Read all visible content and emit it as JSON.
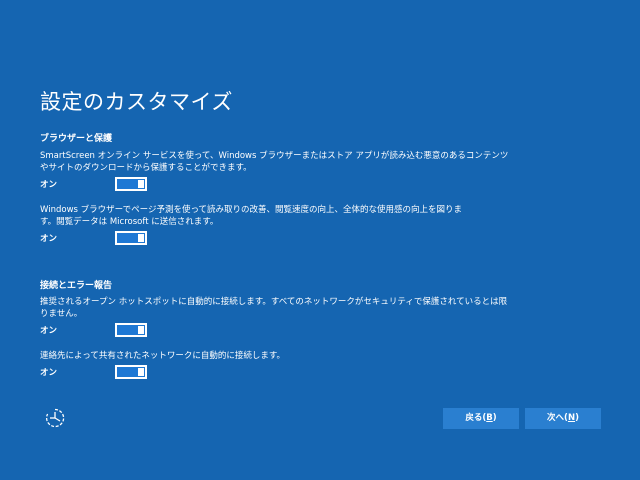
{
  "page": {
    "title": "設定のカスタマイズ"
  },
  "sections": {
    "browser": {
      "heading": "ブラウザーと保護",
      "items": [
        {
          "lines": [
            "SmartScreen オンライン サービスを使って、Windows ブラウザーまたはストア アプリが読み込む悪意のあるコンテンツ",
            "やサイトのダウンロードから保護することができます。"
          ],
          "toggle_label": "オン",
          "state": "on"
        },
        {
          "lines": [
            "Windows ブラウザーでページ予測を使って読み取りの改善、閲覧速度の向上、全体的な使用感の向上を図りま",
            "す。閲覧データは Microsoft に送信されます。"
          ],
          "toggle_label": "オン",
          "state": "on"
        }
      ]
    },
    "connectivity": {
      "heading": "接続とエラー報告",
      "items": [
        {
          "lines": [
            "推奨されるオープン ホットスポットに自動的に接続します。すべてのネットワークがセキュリティで保護されているとは限",
            "りません。"
          ],
          "toggle_label": "オン",
          "state": "on"
        },
        {
          "lines": [
            "連絡先によって共有されたネットワークに自動的に接続します。"
          ],
          "toggle_label": "オン",
          "state": "on"
        }
      ]
    }
  },
  "footer": {
    "accessibility_icon": "ease-of-access-icon",
    "back_label": "戻る(",
    "back_key": "B",
    "back_close": ")",
    "next_label": "次へ(",
    "next_key": "N",
    "next_close": ")"
  },
  "colors": {
    "background": "#1565b1",
    "button": "#2a7fd0",
    "toggle_fill": "#1e78d4",
    "text": "#ffffff"
  }
}
